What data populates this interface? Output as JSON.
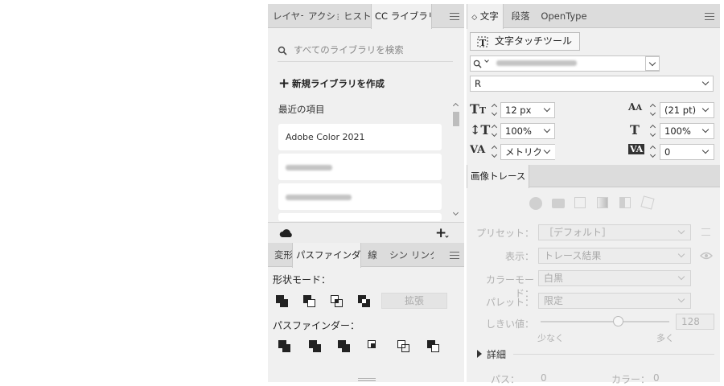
{
  "libraries_panel": {
    "tabs": [
      "レイヤー",
      "アクショ",
      "ヒストリ",
      "CC ライブラリ"
    ],
    "search_placeholder": "すべてのライブラリを検索",
    "new_library_label": "新規ライブラリを作成",
    "recent_heading": "最近の項目",
    "items": [
      "Adobe Color 2021",
      "",
      "",
      ""
    ]
  },
  "pathfinder_panel": {
    "tabs": [
      "変形",
      "パスファインダー",
      "線",
      "シン",
      "リンク"
    ],
    "shape_modes_label": "形状モード：",
    "expand_label": "拡張",
    "pathfinders_label": "パスファインダー："
  },
  "character_panel": {
    "tabs": [
      "文字",
      "段落",
      "OpenType"
    ],
    "touch_tool_label": "文字タッチツール",
    "font_style": "R",
    "font_size": "12 px",
    "leading": "(21 pt)",
    "vertical_scale": "100%",
    "horizontal_scale": "100%",
    "kerning": "メトリクス",
    "tracking": "0"
  },
  "image_trace_panel": {
    "tab": "画像トレース",
    "preset_label": "プリセット：",
    "preset_value": "［デフォルト］",
    "view_label": "表示：",
    "view_value": "トレース結果",
    "mode_label": "カラーモード：",
    "mode_value": "白黒",
    "palette_label": "パレット：",
    "palette_value": "限定",
    "threshold_label": "しきい値：",
    "threshold_value": "128",
    "threshold_fraction": 0.6,
    "less_label": "少なく",
    "more_label": "多く",
    "details_label": "詳細",
    "paths_label": "パス：",
    "paths_value": "0",
    "colors_label": "カラー：",
    "colors_value": "0"
  }
}
